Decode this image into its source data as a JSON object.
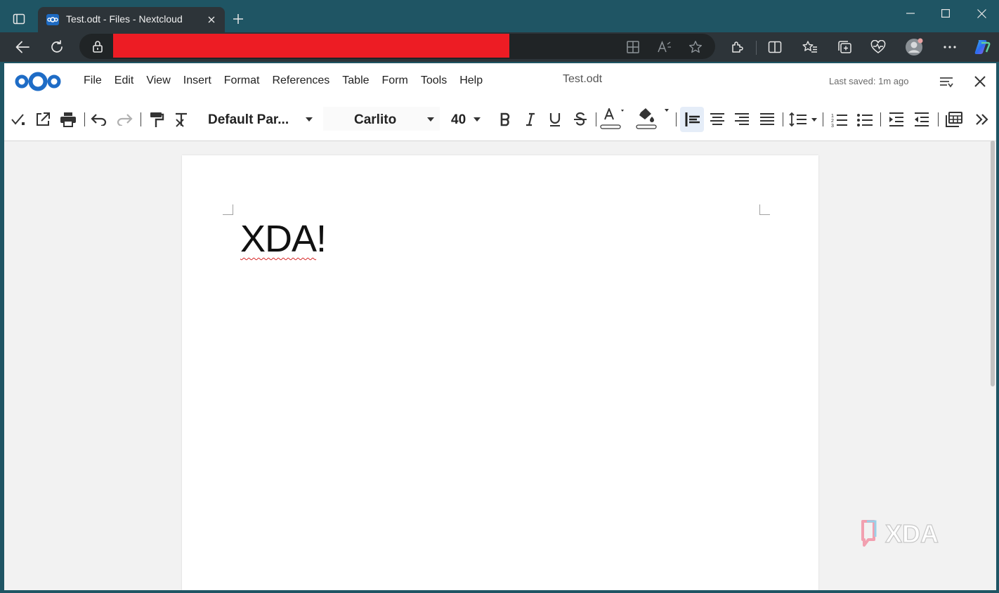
{
  "browser": {
    "tab": {
      "title": "Test.odt - Files - Nextcloud"
    },
    "address": {
      "redacted_text": ""
    }
  },
  "app": {
    "menus": [
      "File",
      "Edit",
      "View",
      "Insert",
      "Format",
      "References",
      "Table",
      "Form",
      "Tools",
      "Help"
    ],
    "doc_title": "Test.odt",
    "last_saved": "Last saved: 1m ago"
  },
  "formatbar": {
    "paragraph_style": "Default Par...",
    "font_name": "Carlito",
    "font_size": "40"
  },
  "document": {
    "text": "XDA",
    "text_suffix": "!"
  },
  "watermark": {
    "text": "XDA"
  },
  "colors": {
    "titlebar": "#1f5564",
    "browser_toolbar": "#2d3439",
    "nextcloud_blue": "#0082c9",
    "redaction": "#ed1c24",
    "active_button_bg": "#e5edf8"
  }
}
